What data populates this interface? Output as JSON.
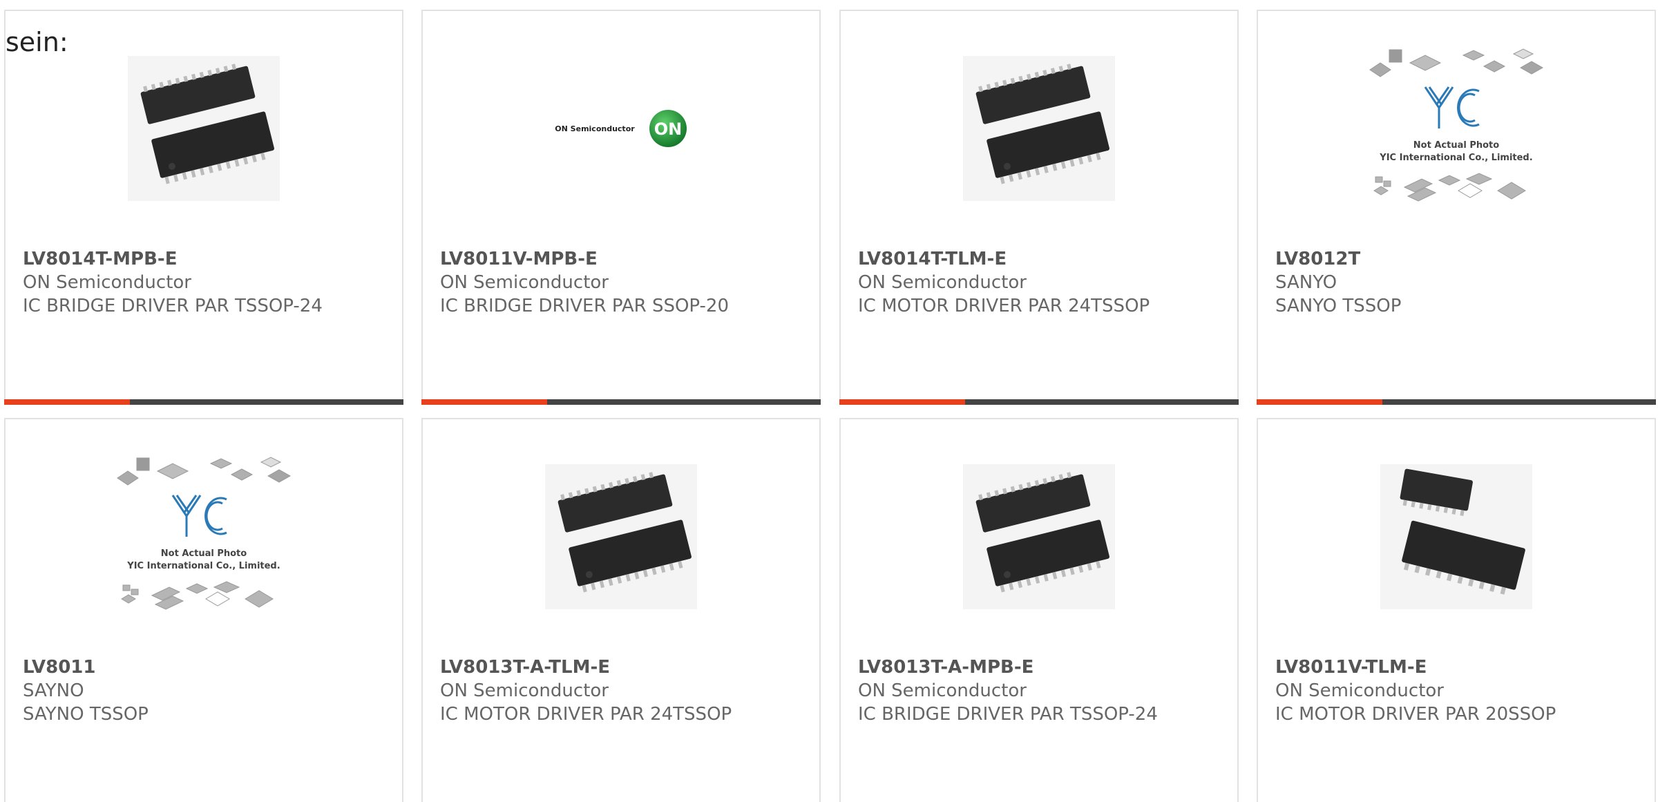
{
  "heading_fragment": "sein:",
  "colors": {
    "accent": "#e8401c",
    "bar": "#444444",
    "text": "#666666",
    "border": "#e2e2e2"
  },
  "products": [
    {
      "part": "LV8014T-MPB-E",
      "maker": "ON Semiconductor",
      "desc": "IC BRIDGE DRIVER PAR TSSOP-24",
      "image": "chip-photo"
    },
    {
      "part": "LV8011V-MPB-E",
      "maker": "ON Semiconductor",
      "desc": "IC BRIDGE DRIVER PAR SSOP-20",
      "image": "on-semiconductor-logo"
    },
    {
      "part": "LV8014T-TLM-E",
      "maker": "ON Semiconductor",
      "desc": "IC MOTOR DRIVER PAR 24TSSOP",
      "image": "chip-photo"
    },
    {
      "part": "LV8012T",
      "maker": "SANYO",
      "desc": "SANYO TSSOP",
      "image": "yic-placeholder"
    },
    {
      "part": "LV8011",
      "maker": "SAYNO",
      "desc": "SAYNO TSSOP",
      "image": "yic-placeholder"
    },
    {
      "part": "LV8013T-A-TLM-E",
      "maker": "ON Semiconductor",
      "desc": "IC MOTOR DRIVER PAR 24TSSOP",
      "image": "chip-photo"
    },
    {
      "part": "LV8013T-A-MPB-E",
      "maker": "ON Semiconductor",
      "desc": "IC BRIDGE DRIVER PAR TSSOP-24",
      "image": "chip-photo"
    },
    {
      "part": "LV8011V-TLM-E",
      "maker": "ON Semiconductor",
      "desc": "IC MOTOR DRIVER PAR 20SSOP",
      "image": "chip-photo-ssop"
    }
  ],
  "placeholder": {
    "line1": "Not Actual Photo",
    "line2": "YIC International Co., Limited."
  },
  "logo_text": "ON Semiconductor",
  "logo_badge": "ON"
}
